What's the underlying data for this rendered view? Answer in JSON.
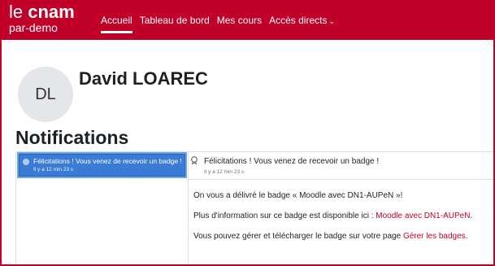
{
  "brand": {
    "le": "le ",
    "cnam": "cnam",
    "subtitle": "par-demo",
    "color": "#c1002a"
  },
  "nav": {
    "items": [
      {
        "label": "Accueil",
        "active": true
      },
      {
        "label": "Tableau de bord"
      },
      {
        "label": "Mes cours"
      },
      {
        "label": "Accès directs",
        "chevron": "⌄"
      }
    ]
  },
  "profile": {
    "initials": "DL",
    "name": "David LOAREC"
  },
  "page": {
    "title": "Notifications"
  },
  "notifications": {
    "list": [
      {
        "title": "Félicitations ! Vous venez de recevoir un badge !",
        "time": "Il y a 12 min 23 s",
        "selected": true
      }
    ],
    "detail": {
      "icon": "badge-icon",
      "title": "Félicitations ! Vous venez de recevoir un badge !",
      "time": "Il y a 12 min 23 s",
      "body": {
        "line1": "On vous a délivré le badge « Moodle avec DN1-AUPeN »!",
        "line2_prefix": "Plus d'information sur ce badge est disponible ici : ",
        "line2_link": "Moodle avec DN1-AUPeN",
        "line2_suffix": ".",
        "line3_prefix": "Vous pouvez gérer et télécharger le badge sur votre page ",
        "line3_link": "Gérer les badges",
        "line3_suffix": "."
      }
    }
  },
  "colors": {
    "accent": "#c1002a",
    "selection": "#3a7bd5"
  }
}
